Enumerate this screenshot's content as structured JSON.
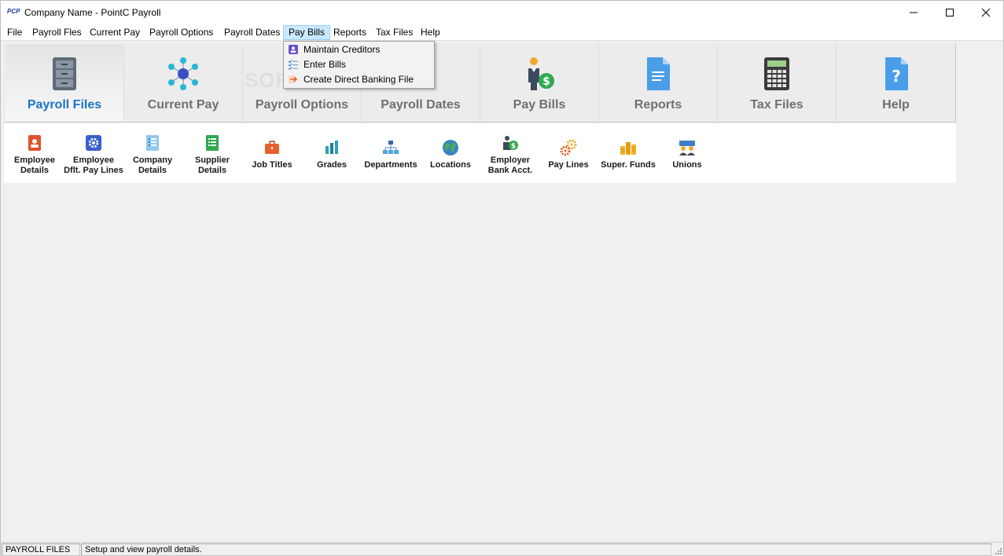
{
  "window": {
    "logo_text": "PCP",
    "title": "Company Name - PointC Payroll"
  },
  "menubar": {
    "items": [
      "File",
      "Payroll Fles",
      "Current Pay",
      "Payroll Options",
      "Payroll Dates",
      "Pay Bills",
      "Reports",
      "Tax Files",
      "Help"
    ],
    "active": "Pay Bills"
  },
  "ribbon": {
    "tabs": [
      {
        "label": "Payroll Files",
        "icon": "filing-cabinet-icon",
        "selected": true
      },
      {
        "label": "Current Pay",
        "icon": "network-nodes-icon",
        "selected": false
      },
      {
        "label": "Payroll Options",
        "icon": "options-icon",
        "selected": false
      },
      {
        "label": "Payroll Dates",
        "icon": "calendar-icon",
        "selected": false
      },
      {
        "label": "Pay Bills",
        "icon": "person-money-icon",
        "selected": false
      },
      {
        "label": "Reports",
        "icon": "document-icon",
        "selected": false
      },
      {
        "label": "Tax Files",
        "icon": "calculator-icon",
        "selected": false
      },
      {
        "label": "Help",
        "icon": "help-document-icon",
        "selected": false
      }
    ],
    "accent_color": "#1e74c9"
  },
  "subtoolbar": {
    "items": [
      {
        "line1": "Employee",
        "line2": "Details",
        "icon": "employee-card-icon",
        "color": "#e0522b"
      },
      {
        "line1": "Employee",
        "line2": "Dflt. Pay Lines",
        "icon": "gear-badge-icon",
        "color": "#3a5fcd"
      },
      {
        "line1": "Company",
        "line2": "Details",
        "icon": "list-document-icon",
        "color": "#5aaee0"
      },
      {
        "line1": "Supplier",
        "line2": "Details",
        "icon": "green-list-icon",
        "color": "#2fa84f"
      },
      {
        "line1": "Job Titles",
        "line2": "",
        "icon": "briefcase-icon",
        "color": "#e8602c"
      },
      {
        "line1": "Grades",
        "line2": "",
        "icon": "bar-chart-icon",
        "color": "#27a3b8"
      },
      {
        "line1": "Departments",
        "line2": "",
        "icon": "org-chart-icon",
        "color": "#3d7ec9"
      },
      {
        "line1": "Locations",
        "line2": "",
        "icon": "globe-icon",
        "color": "#2e8b57"
      },
      {
        "line1": "Employer",
        "line2": "Bank Acct.",
        "icon": "bank-person-icon",
        "color": "#2fa84f"
      },
      {
        "line1": "Pay Lines",
        "line2": "",
        "icon": "gears-icon",
        "color": "#e8602c"
      },
      {
        "line1": "Super. Funds",
        "line2": "",
        "icon": "coin-stacks-icon",
        "color": "#f0b429"
      },
      {
        "line1": "Unions",
        "line2": "",
        "icon": "group-icon",
        "color": "#3d7ec9"
      }
    ]
  },
  "dropdown": {
    "items": [
      {
        "label": "Maintain Creditors",
        "icon": "person-card-icon"
      },
      {
        "label": "Enter Bills",
        "icon": "checklist-icon"
      },
      {
        "label": "Create Direct Banking File",
        "icon": "arrow-right-icon"
      }
    ]
  },
  "watermark": "SOFTPEDIA",
  "statusbar": {
    "section": "PAYROLL FILES",
    "message": "Setup and view payroll details."
  }
}
